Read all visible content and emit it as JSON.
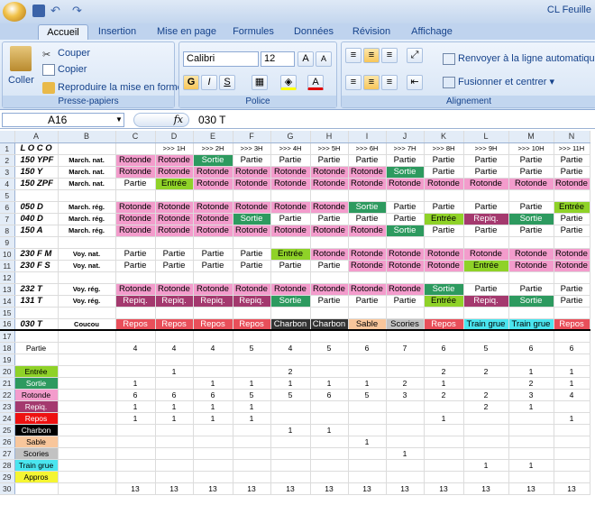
{
  "window": {
    "title": "CL Feuille"
  },
  "tabs": [
    "Accueil",
    "Insertion",
    "Mise en page",
    "Formules",
    "Données",
    "Révision",
    "Affichage"
  ],
  "active_tab": "Accueil",
  "clipboard": {
    "paste": "Coller",
    "cut": "Couper",
    "copy": "Copier",
    "format_painter": "Reproduire la mise en forme",
    "group": "Presse-papiers"
  },
  "font": {
    "name": "Calibri",
    "size": "12",
    "bold": "G",
    "italic": "I",
    "underline": "S",
    "group": "Police"
  },
  "alignment": {
    "wrap": "Renvoyer à la ligne automatique",
    "merge": "Fusionner et centrer",
    "group": "Alignement"
  },
  "formula_bar": {
    "name_box": "A16",
    "fx": "fx",
    "value": "030 T"
  },
  "columns": [
    "A",
    "B",
    "C",
    "D",
    "E",
    "F",
    "G",
    "H",
    "I",
    "J",
    "K",
    "L",
    "M",
    "N"
  ],
  "rows": [
    {
      "n": "1",
      "cells": [
        "L O C O",
        "",
        "",
        ">>> 1H",
        ">>> 2H",
        ">>> 3H",
        ">>> 4H",
        ">>> 5H",
        ">>> 6H",
        ">>> 7H",
        ">>> 8H",
        ">>> 9H",
        ">>> 10H",
        ">>> 11H",
        ">>> 12H"
      ]
    },
    {
      "n": "2",
      "cells": [
        "150 YPF",
        "March. nat.",
        "Rotonde",
        "Rotonde",
        "Sortie",
        "Partie",
        "Partie",
        "Partie",
        "Partie",
        "Partie",
        "Partie",
        "Partie",
        "Partie",
        "Partie"
      ]
    },
    {
      "n": "3",
      "cells": [
        "150 Y",
        "March. nat.",
        "Rotonde",
        "Rotonde",
        "Rotonde",
        "Rotonde",
        "Rotonde",
        "Rotonde",
        "Rotonde",
        "Sortie",
        "Partie",
        "Partie",
        "Partie",
        "Partie"
      ]
    },
    {
      "n": "4",
      "cells": [
        "150 ZPF",
        "March. nat.",
        "Partie",
        "Entrée",
        "Rotonde",
        "Rotonde",
        "Rotonde",
        "Rotonde",
        "Rotonde",
        "Rotonde",
        "Rotonde",
        "Rotonde",
        "Rotonde",
        "Rotonde"
      ]
    },
    {
      "n": "5",
      "cells": [
        "",
        "",
        "",
        "",
        "",
        "",
        "",
        "",
        "",
        "",
        "",
        "",
        "",
        ""
      ]
    },
    {
      "n": "6",
      "cells": [
        "050 D",
        "March. rég.",
        "Rotonde",
        "Rotonde",
        "Rotonde",
        "Rotonde",
        "Rotonde",
        "Rotonde",
        "Sortie",
        "Partie",
        "Partie",
        "Partie",
        "Partie",
        "Entrée"
      ]
    },
    {
      "n": "7",
      "cells": [
        "040 D",
        "March. rég.",
        "Rotonde",
        "Rotonde",
        "Rotonde",
        "Sortie",
        "Partie",
        "Partie",
        "Partie",
        "Partie",
        "Entrée",
        "Repiq.",
        "Sortie",
        "Partie"
      ]
    },
    {
      "n": "8",
      "cells": [
        "150 A",
        "March. rég.",
        "Rotonde",
        "Rotonde",
        "Rotonde",
        "Rotonde",
        "Rotonde",
        "Rotonde",
        "Rotonde",
        "Sortie",
        "Partie",
        "Partie",
        "Partie",
        "Partie"
      ]
    },
    {
      "n": "9",
      "cells": [
        "",
        "",
        "",
        "",
        "",
        "",
        "",
        "",
        "",
        "",
        "",
        "",
        "",
        ""
      ]
    },
    {
      "n": "10",
      "cells": [
        "230 F M",
        "Voy. nat.",
        "Partie",
        "Partie",
        "Partie",
        "Partie",
        "Entrée",
        "Rotonde",
        "Rotonde",
        "Rotonde",
        "Rotonde",
        "Rotonde",
        "Rotonde",
        "Rotonde"
      ]
    },
    {
      "n": "11",
      "cells": [
        "230 F S",
        "Voy. nat.",
        "Partie",
        "Partie",
        "Partie",
        "Partie",
        "Partie",
        "Partie",
        "Rotonde",
        "Rotonde",
        "Rotonde",
        "Entrée",
        "Rotonde",
        "Rotonde"
      ]
    },
    {
      "n": "12",
      "cells": [
        "",
        "",
        "",
        "",
        "",
        "",
        "",
        "",
        "",
        "",
        "",
        "",
        "",
        ""
      ]
    },
    {
      "n": "13",
      "cells": [
        "232 T",
        "Voy. rég.",
        "Rotonde",
        "Rotonde",
        "Rotonde",
        "Rotonde",
        "Rotonde",
        "Rotonde",
        "Rotonde",
        "Rotonde",
        "Sortie",
        "Partie",
        "Partie",
        "Partie"
      ]
    },
    {
      "n": "14",
      "cells": [
        "131 T",
        "Voy. rég.",
        "Repiq.",
        "Repiq.",
        "Repiq.",
        "Repiq.",
        "Sortie",
        "Partie",
        "Partie",
        "Partie",
        "Entrée",
        "Repiq.",
        "Sortie",
        "Partie"
      ]
    },
    {
      "n": "15",
      "cells": [
        "",
        "",
        "",
        "",
        "",
        "",
        "",
        "",
        "",
        "",
        "",
        "",
        "",
        ""
      ]
    },
    {
      "n": "16",
      "cells": [
        "030 T",
        "Coucou",
        "Repos",
        "Repos",
        "Repos",
        "Repos",
        "Charbon",
        "Charbon",
        "Sable",
        "Scories",
        "Repos",
        "Train grue",
        "Train grue",
        "Repos"
      ]
    },
    {
      "n": "17",
      "cells": [
        "",
        "",
        "",
        "",
        "",
        "",
        "",
        "",
        "",
        "",
        "",
        "",
        "",
        ""
      ]
    },
    {
      "n": "18",
      "cells": [
        "Partie",
        "",
        "4",
        "4",
        "4",
        "5",
        "4",
        "5",
        "6",
        "7",
        "6",
        "5",
        "6",
        "6"
      ]
    },
    {
      "n": "19",
      "cells": [
        "",
        "",
        "",
        "",
        "",
        "",
        "",
        "",
        "",
        "",
        "",
        "",
        "",
        ""
      ]
    },
    {
      "n": "20",
      "cells": [
        "Entrée",
        "",
        "",
        "1",
        "",
        "",
        "2",
        "",
        "",
        "",
        "2",
        "2",
        "1",
        "1"
      ]
    },
    {
      "n": "21",
      "cells": [
        "Sortie",
        "",
        "1",
        "",
        "1",
        "1",
        "1",
        "1",
        "1",
        "2",
        "1",
        "",
        "2",
        "1"
      ]
    },
    {
      "n": "22",
      "cells": [
        "Rotonde",
        "",
        "6",
        "6",
        "6",
        "5",
        "5",
        "6",
        "5",
        "3",
        "2",
        "2",
        "3",
        "4"
      ]
    },
    {
      "n": "23",
      "cells": [
        "Repiq.",
        "",
        "1",
        "1",
        "1",
        "1",
        "",
        "",
        "",
        "",
        "",
        "2",
        "1",
        ""
      ]
    },
    {
      "n": "24",
      "cells": [
        "Repos",
        "",
        "1",
        "1",
        "1",
        "1",
        "",
        "",
        "",
        "",
        "1",
        "",
        "",
        "1"
      ]
    },
    {
      "n": "25",
      "cells": [
        "Charbon",
        "",
        "",
        "",
        "",
        "",
        "1",
        "1",
        "",
        "",
        "",
        "",
        "",
        ""
      ]
    },
    {
      "n": "26",
      "cells": [
        "Sable",
        "",
        "",
        "",
        "",
        "",
        "",
        "",
        "1",
        "",
        "",
        "",
        "",
        ""
      ]
    },
    {
      "n": "27",
      "cells": [
        "Scories",
        "",
        "",
        "",
        "",
        "",
        "",
        "",
        "",
        "1",
        "",
        "",
        "",
        ""
      ]
    },
    {
      "n": "28",
      "cells": [
        "Train grue",
        "",
        "",
        "",
        "",
        "",
        "",
        "",
        "",
        "",
        "",
        "1",
        "1",
        ""
      ]
    },
    {
      "n": "29",
      "cells": [
        "Appros",
        "",
        "",
        "",
        "",
        "",
        "",
        "",
        "",
        "",
        "",
        "",
        "",
        ""
      ]
    },
    {
      "n": "30",
      "cells": [
        "",
        "",
        "13",
        "13",
        "13",
        "13",
        "13",
        "13",
        "13",
        "13",
        "13",
        "13",
        "13",
        "13"
      ]
    }
  ],
  "colors": {
    "Rotonde": "#f39ccc",
    "Sortie": "#2d9a5f",
    "Entree": "#8fd228",
    "Repiq": "#a4396e",
    "Repos": "#e94f5a",
    "Charbon": "#333333",
    "Sable": "#f8c69b",
    "Scories": "#c2c2c2",
    "Train grue": "#4ae5ef",
    "Appros": "#f5f532"
  }
}
